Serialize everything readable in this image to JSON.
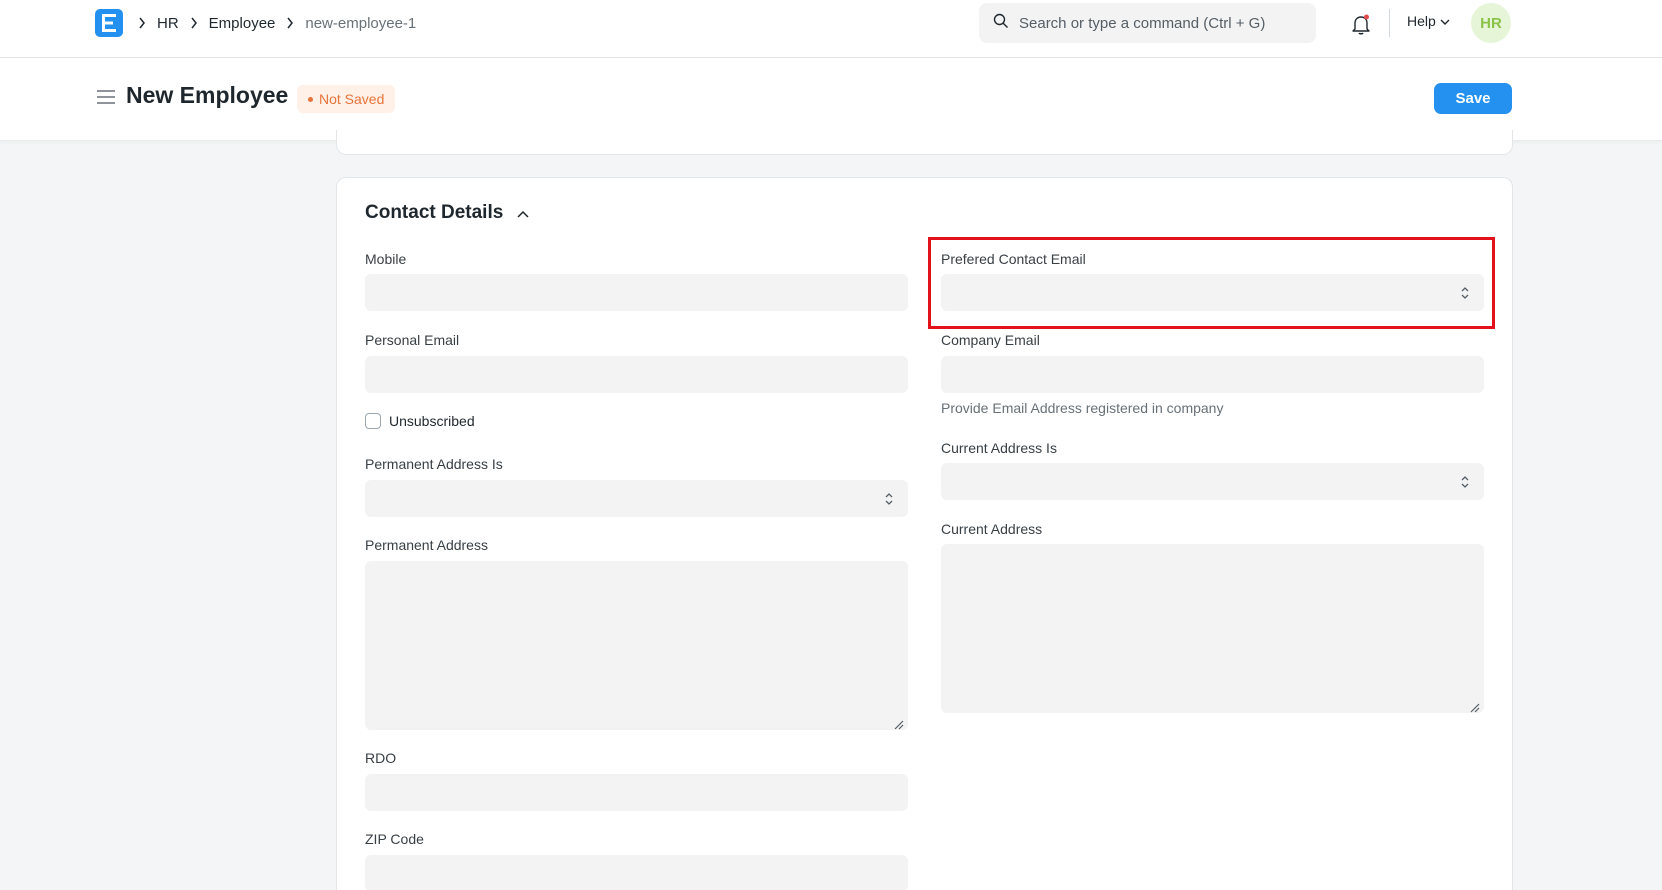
{
  "navbar": {
    "breadcrumbs": [
      "HR",
      "Employee",
      "new-employee-1"
    ],
    "search_placeholder": "Search or type a command (Ctrl + G)",
    "help_label": "Help",
    "avatar_initials": "HR"
  },
  "page": {
    "title": "New Employee",
    "status": "Not Saved",
    "save_label": "Save"
  },
  "contact_details": {
    "section_title": "Contact Details",
    "left": {
      "mobile_label": "Mobile",
      "personal_email_label": "Personal Email",
      "unsubscribed_label": "Unsubscribed",
      "permanent_address_is_label": "Permanent Address Is",
      "permanent_address_label": "Permanent Address",
      "rdo_label": "RDO",
      "zip_code_label": "ZIP Code"
    },
    "right": {
      "prefered_contact_email_label": "Prefered Contact Email",
      "company_email_label": "Company Email",
      "company_email_description": "Provide Email Address registered in company",
      "current_address_is_label": "Current Address Is",
      "current_address_label": "Current Address"
    }
  },
  "colors": {
    "primary": "#2490ef",
    "status_orange": "#e8743b",
    "highlight_red": "#e3111b"
  }
}
